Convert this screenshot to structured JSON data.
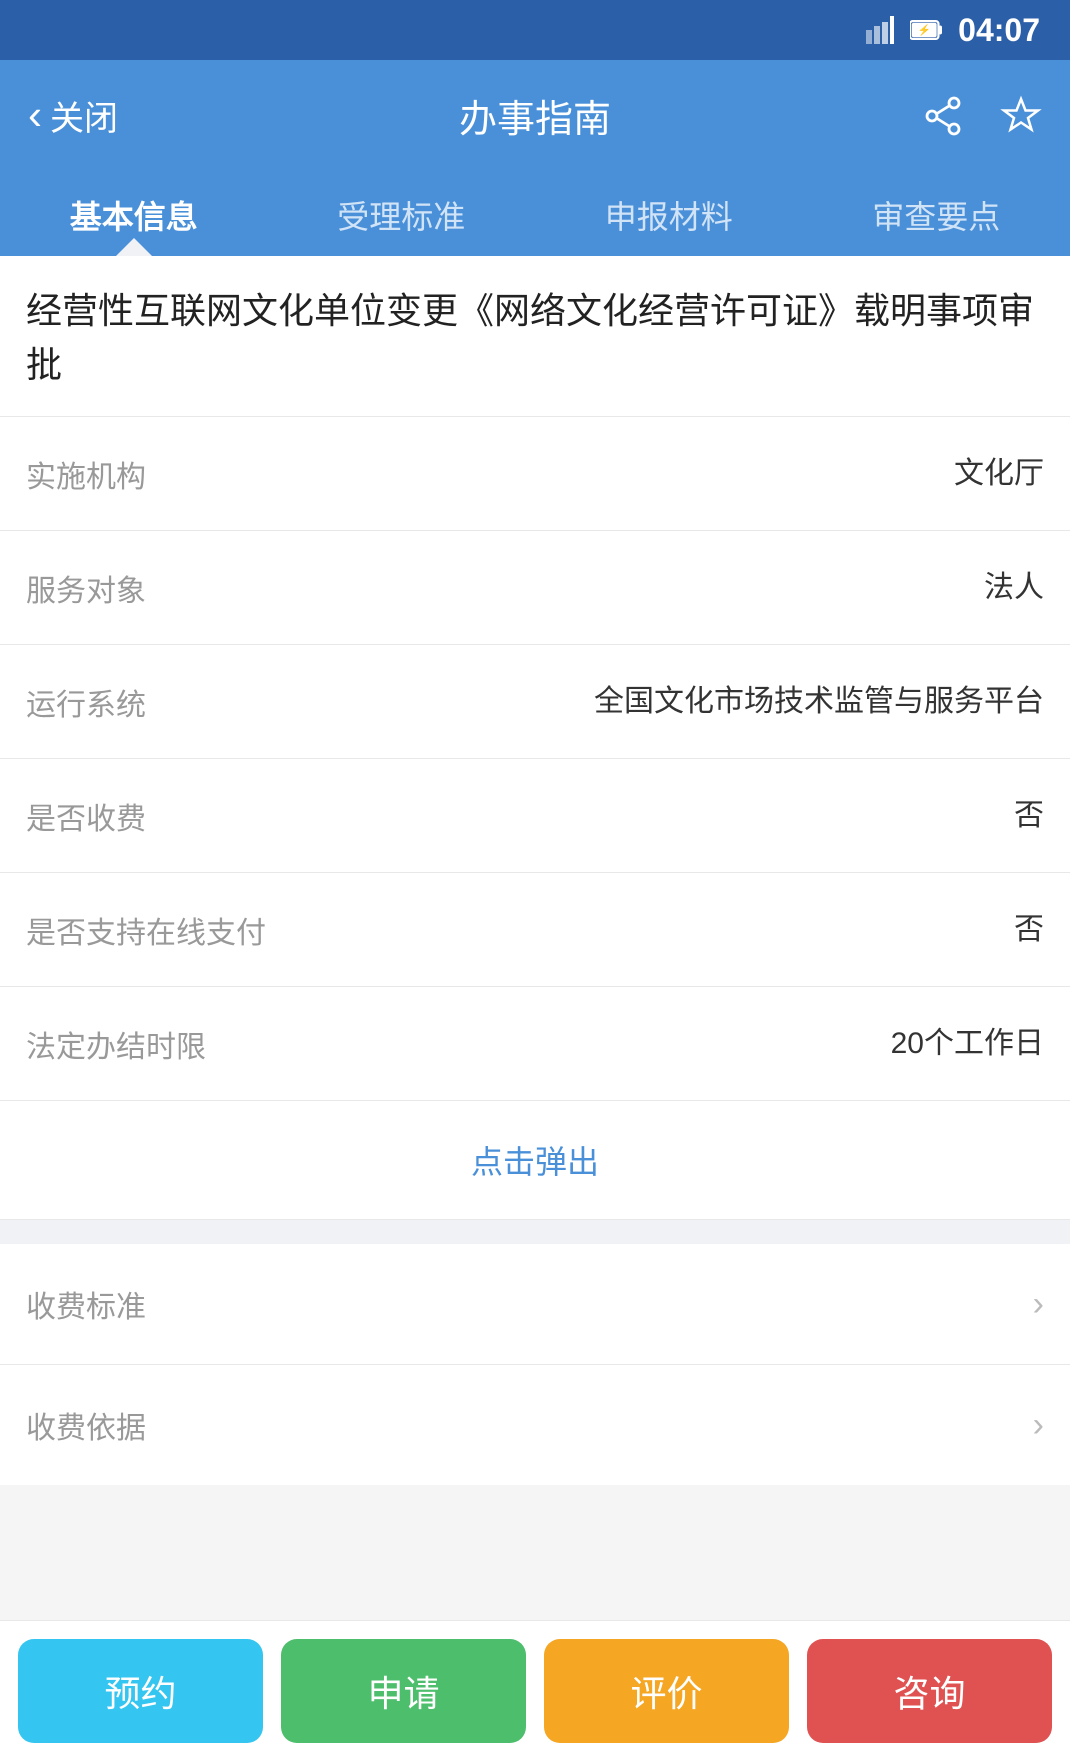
{
  "statusBar": {
    "time": "04:07"
  },
  "navBar": {
    "backLabel": "关闭",
    "title": "办事指南",
    "shareIconLabel": "share-icon",
    "starIconLabel": "star-icon"
  },
  "tabs": [
    {
      "id": "basic",
      "label": "基本信息",
      "active": true
    },
    {
      "id": "standard",
      "label": "受理标准",
      "active": false
    },
    {
      "id": "materials",
      "label": "申报材料",
      "active": false
    },
    {
      "id": "review",
      "label": "审查要点",
      "active": false
    }
  ],
  "pageTitle": "经营性互联网文化单位变更《网络文化经营许可证》载明事项审批",
  "infoRows": [
    {
      "label": "实施机构",
      "value": "文化厅"
    },
    {
      "label": "服务对象",
      "value": "法人"
    },
    {
      "label": "运行系统",
      "value": "全国文化市场技术监管与服务平台"
    },
    {
      "label": "是否收费",
      "value": "否"
    },
    {
      "label": "是否支持在线支付",
      "value": "否"
    },
    {
      "label": "法定办结时限",
      "value": "20个工作日"
    }
  ],
  "popupButtonLabel": "点击弹出",
  "listRows": [
    {
      "label": "收费标准",
      "hasArrow": true
    },
    {
      "label": "收费依据",
      "hasArrow": true
    }
  ],
  "bottomActions": [
    {
      "id": "reserve",
      "label": "预约",
      "colorClass": "action-btn-reserve"
    },
    {
      "id": "apply",
      "label": "申请",
      "colorClass": "action-btn-apply"
    },
    {
      "id": "rate",
      "label": "评价",
      "colorClass": "action-btn-rate"
    },
    {
      "id": "consult",
      "label": "咨询",
      "colorClass": "action-btn-consult"
    }
  ]
}
